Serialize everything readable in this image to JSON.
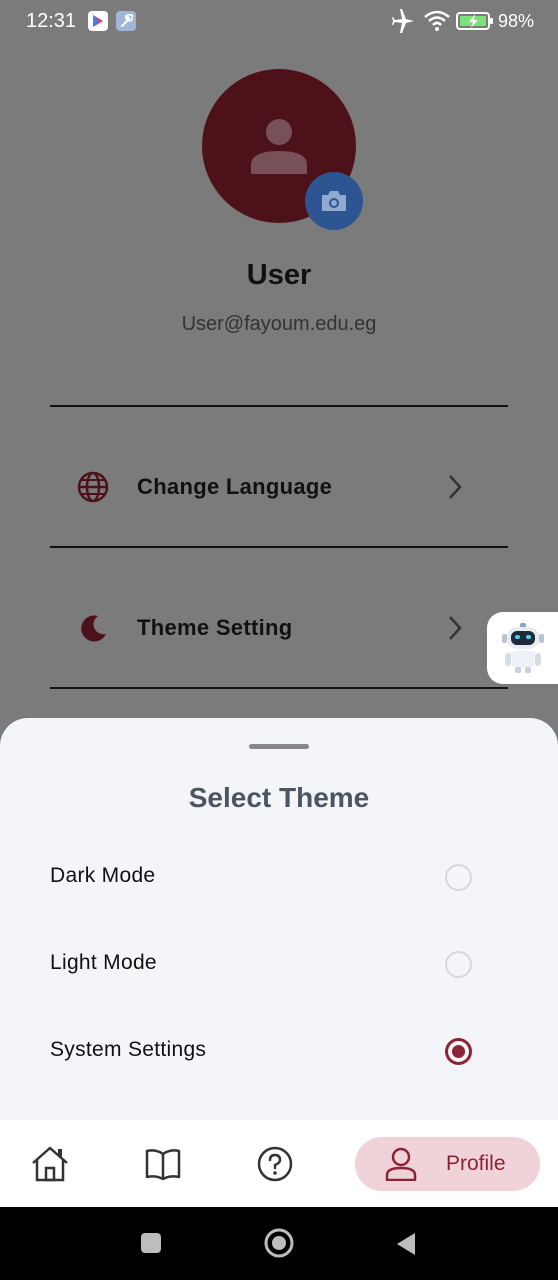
{
  "status_bar": {
    "time": "12:31",
    "battery": "98%",
    "icons": [
      "play-store-icon",
      "wrench-icon",
      "airplane-icon",
      "wifi-icon",
      "battery-charging-icon"
    ]
  },
  "profile": {
    "name": "User",
    "email": "User@fayoum.edu.eg"
  },
  "menu": {
    "items": [
      {
        "label": "Change Language",
        "icon": "globe-icon"
      },
      {
        "label": "Theme Setting",
        "icon": "moon-icon"
      }
    ]
  },
  "sheet": {
    "title": "Select Theme",
    "options": [
      {
        "label": "Dark Mode",
        "selected": false
      },
      {
        "label": "Light Mode",
        "selected": false
      },
      {
        "label": "System Settings",
        "selected": true
      }
    ]
  },
  "bottom_nav": {
    "items": [
      "home-icon",
      "book-icon",
      "help-icon"
    ],
    "active_label": "Profile"
  },
  "colors": {
    "brand": "#8f2336",
    "avatar_bg": "#4d111a",
    "camera_button": "#2c5591",
    "active_tab_bg": "#f0d3d8"
  }
}
